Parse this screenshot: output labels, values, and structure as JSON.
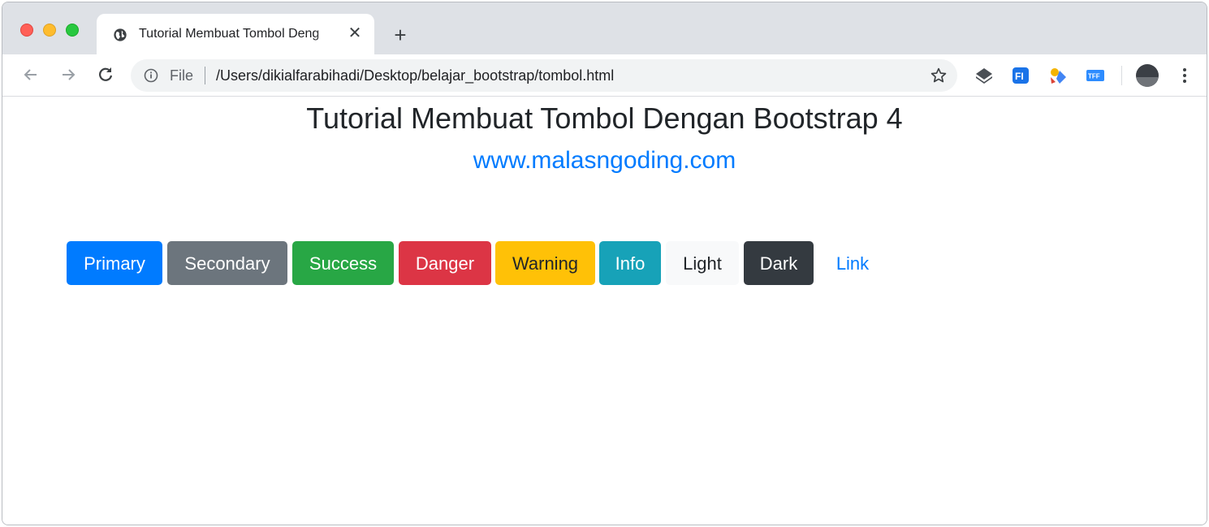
{
  "browser": {
    "tab": {
      "title": "Tutorial Membuat Tombol Deng",
      "favicon": "globe-icon",
      "close_glyph": "✕"
    },
    "new_tab_glyph": "+",
    "address_bar": {
      "scheme_label": "File",
      "url": "/Users/dikialfarabihadi/Desktop/belajar_bootstrap/tombol.html"
    },
    "extensions": [
      "layers-icon",
      "fi-extension-icon",
      "sparkle-extension-icon",
      "tff-extension-icon"
    ]
  },
  "page": {
    "title": "Tutorial Membuat Tombol Dengan Bootstrap 4",
    "subtitle": "www.malasngoding.com",
    "buttons": [
      {
        "label": "Primary",
        "color": "#007bff"
      },
      {
        "label": "Secondary",
        "color": "#6c757d"
      },
      {
        "label": "Success",
        "color": "#28a745"
      },
      {
        "label": "Danger",
        "color": "#dc3545"
      },
      {
        "label": "Warning",
        "color": "#ffc107"
      },
      {
        "label": "Info",
        "color": "#17a2b8"
      },
      {
        "label": "Light",
        "color": "#f8f9fa"
      },
      {
        "label": "Dark",
        "color": "#343a40"
      },
      {
        "label": "Link",
        "color": "#007bff"
      }
    ]
  }
}
